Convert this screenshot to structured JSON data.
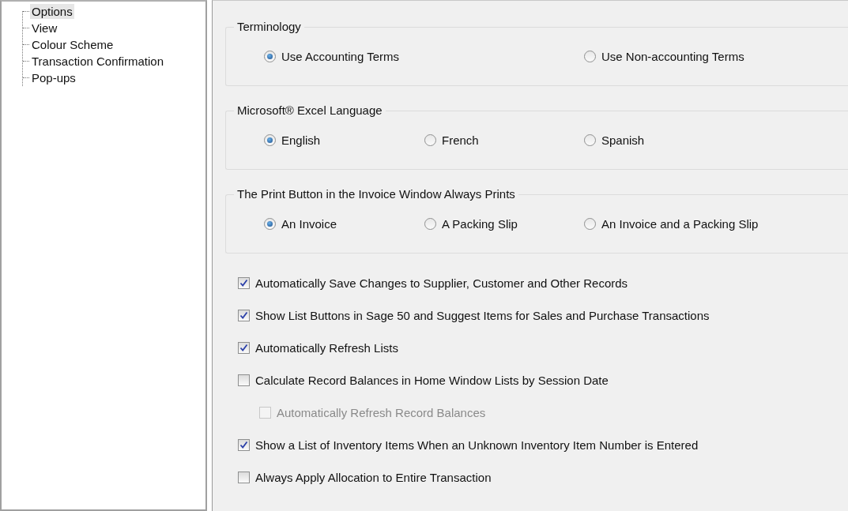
{
  "sidebar": {
    "items": [
      {
        "label": "Options",
        "selected": true
      },
      {
        "label": "View",
        "selected": false
      },
      {
        "label": "Colour Scheme",
        "selected": false
      },
      {
        "label": "Transaction Confirmation",
        "selected": false
      },
      {
        "label": "Pop-ups",
        "selected": false
      }
    ]
  },
  "groups": [
    {
      "legend": "Terminology",
      "options": [
        {
          "label": "Use Accounting Terms",
          "selected": true
        },
        {
          "label": "Use Non-accounting Terms",
          "selected": false
        }
      ]
    },
    {
      "legend": "Microsoft® Excel Language",
      "options": [
        {
          "label": "English",
          "selected": true
        },
        {
          "label": "French",
          "selected": false
        },
        {
          "label": "Spanish",
          "selected": false
        }
      ]
    },
    {
      "legend": "The Print Button in the Invoice Window Always Prints",
      "options": [
        {
          "label": "An Invoice",
          "selected": true
        },
        {
          "label": "A Packing Slip",
          "selected": false
        },
        {
          "label": "An Invoice and a Packing Slip",
          "selected": false
        }
      ]
    }
  ],
  "checkboxes": [
    {
      "label": "Automatically Save Changes to Supplier, Customer and Other Records",
      "checked": true,
      "disabled": false
    },
    {
      "label": "Show List Buttons in Sage 50 and Suggest Items for Sales and Purchase Transactions",
      "checked": true,
      "disabled": false
    },
    {
      "label": "Automatically Refresh Lists",
      "checked": true,
      "disabled": false
    },
    {
      "label": "Calculate Record Balances in Home Window Lists by Session Date",
      "checked": false,
      "disabled": false,
      "children": [
        {
          "label": "Automatically Refresh Record Balances",
          "checked": false,
          "disabled": true
        }
      ]
    },
    {
      "label": "Show a List of Inventory Items When an Unknown Inventory Item Number is Entered",
      "checked": true,
      "disabled": false
    },
    {
      "label": "Always Apply Allocation to Entire Transaction",
      "checked": false,
      "disabled": false
    }
  ]
}
